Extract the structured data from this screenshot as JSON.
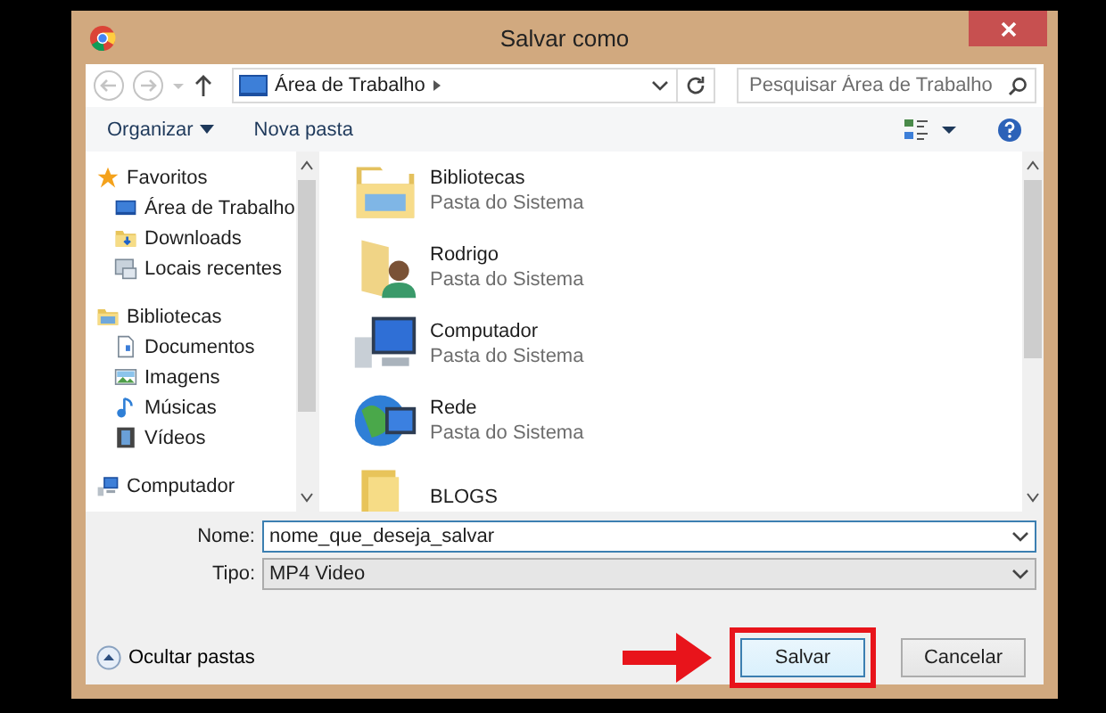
{
  "window": {
    "title": "Salvar como"
  },
  "address": {
    "path": "Área de Trabalho"
  },
  "search": {
    "placeholder": "Pesquisar Área de Trabalho"
  },
  "toolbar": {
    "organize": "Organizar",
    "new_folder": "Nova pasta"
  },
  "sidebar": {
    "items": [
      {
        "label": "Favoritos",
        "children": [
          {
            "label": "Área de Trabalho"
          },
          {
            "label": "Downloads"
          },
          {
            "label": "Locais recentes"
          }
        ]
      },
      {
        "label": "Bibliotecas",
        "children": [
          {
            "label": "Documentos"
          },
          {
            "label": "Imagens"
          },
          {
            "label": "Músicas"
          },
          {
            "label": "Vídeos"
          }
        ]
      },
      {
        "label": "Computador"
      }
    ]
  },
  "items": [
    {
      "name": "Bibliotecas",
      "type": "Pasta do Sistema"
    },
    {
      "name": "Rodrigo",
      "type": "Pasta do Sistema"
    },
    {
      "name": "Computador",
      "type": "Pasta do Sistema"
    },
    {
      "name": "Rede",
      "type": "Pasta do Sistema"
    },
    {
      "name": "BLOGS"
    }
  ],
  "form": {
    "name_label": "Nome:",
    "name_value": "nome_que_deseja_salvar",
    "type_label": "Tipo:",
    "type_value": "MP4 Video"
  },
  "hide_folders": "Ocultar pastas",
  "buttons": [
    {
      "label": "Salvar",
      "annotated": true
    },
    {
      "label": "Cancelar",
      "annotated": false
    }
  ]
}
